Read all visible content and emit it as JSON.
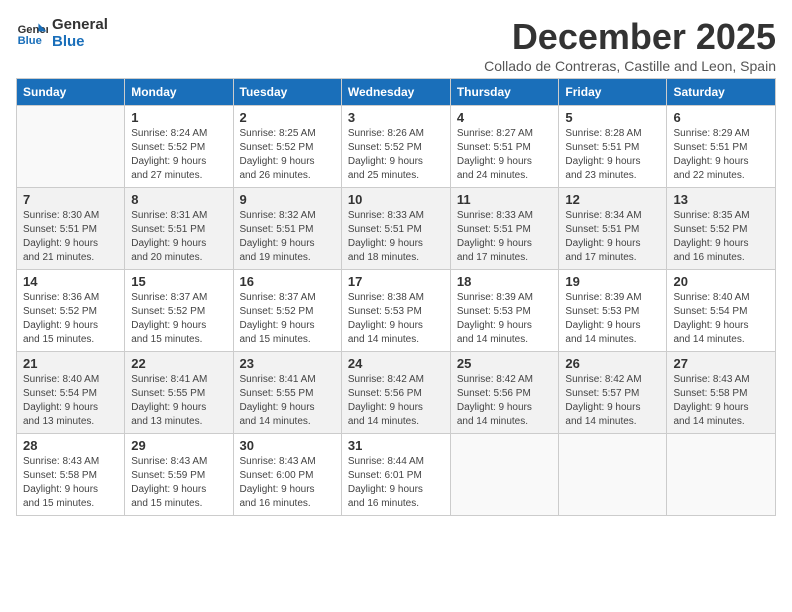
{
  "logo": {
    "line1": "General",
    "line2": "Blue"
  },
  "title": "December 2025",
  "subtitle": "Collado de Contreras, Castille and Leon, Spain",
  "weekdays": [
    "Sunday",
    "Monday",
    "Tuesday",
    "Wednesday",
    "Thursday",
    "Friday",
    "Saturday"
  ],
  "weeks": [
    [
      {
        "day": "",
        "info": ""
      },
      {
        "day": "1",
        "info": "Sunrise: 8:24 AM\nSunset: 5:52 PM\nDaylight: 9 hours\nand 27 minutes."
      },
      {
        "day": "2",
        "info": "Sunrise: 8:25 AM\nSunset: 5:52 PM\nDaylight: 9 hours\nand 26 minutes."
      },
      {
        "day": "3",
        "info": "Sunrise: 8:26 AM\nSunset: 5:52 PM\nDaylight: 9 hours\nand 25 minutes."
      },
      {
        "day": "4",
        "info": "Sunrise: 8:27 AM\nSunset: 5:51 PM\nDaylight: 9 hours\nand 24 minutes."
      },
      {
        "day": "5",
        "info": "Sunrise: 8:28 AM\nSunset: 5:51 PM\nDaylight: 9 hours\nand 23 minutes."
      },
      {
        "day": "6",
        "info": "Sunrise: 8:29 AM\nSunset: 5:51 PM\nDaylight: 9 hours\nand 22 minutes."
      }
    ],
    [
      {
        "day": "7",
        "info": "Sunrise: 8:30 AM\nSunset: 5:51 PM\nDaylight: 9 hours\nand 21 minutes."
      },
      {
        "day": "8",
        "info": "Sunrise: 8:31 AM\nSunset: 5:51 PM\nDaylight: 9 hours\nand 20 minutes."
      },
      {
        "day": "9",
        "info": "Sunrise: 8:32 AM\nSunset: 5:51 PM\nDaylight: 9 hours\nand 19 minutes."
      },
      {
        "day": "10",
        "info": "Sunrise: 8:33 AM\nSunset: 5:51 PM\nDaylight: 9 hours\nand 18 minutes."
      },
      {
        "day": "11",
        "info": "Sunrise: 8:33 AM\nSunset: 5:51 PM\nDaylight: 9 hours\nand 17 minutes."
      },
      {
        "day": "12",
        "info": "Sunrise: 8:34 AM\nSunset: 5:51 PM\nDaylight: 9 hours\nand 17 minutes."
      },
      {
        "day": "13",
        "info": "Sunrise: 8:35 AM\nSunset: 5:52 PM\nDaylight: 9 hours\nand 16 minutes."
      }
    ],
    [
      {
        "day": "14",
        "info": "Sunrise: 8:36 AM\nSunset: 5:52 PM\nDaylight: 9 hours\nand 15 minutes."
      },
      {
        "day": "15",
        "info": "Sunrise: 8:37 AM\nSunset: 5:52 PM\nDaylight: 9 hours\nand 15 minutes."
      },
      {
        "day": "16",
        "info": "Sunrise: 8:37 AM\nSunset: 5:52 PM\nDaylight: 9 hours\nand 15 minutes."
      },
      {
        "day": "17",
        "info": "Sunrise: 8:38 AM\nSunset: 5:53 PM\nDaylight: 9 hours\nand 14 minutes."
      },
      {
        "day": "18",
        "info": "Sunrise: 8:39 AM\nSunset: 5:53 PM\nDaylight: 9 hours\nand 14 minutes."
      },
      {
        "day": "19",
        "info": "Sunrise: 8:39 AM\nSunset: 5:53 PM\nDaylight: 9 hours\nand 14 minutes."
      },
      {
        "day": "20",
        "info": "Sunrise: 8:40 AM\nSunset: 5:54 PM\nDaylight: 9 hours\nand 14 minutes."
      }
    ],
    [
      {
        "day": "21",
        "info": "Sunrise: 8:40 AM\nSunset: 5:54 PM\nDaylight: 9 hours\nand 13 minutes."
      },
      {
        "day": "22",
        "info": "Sunrise: 8:41 AM\nSunset: 5:55 PM\nDaylight: 9 hours\nand 13 minutes."
      },
      {
        "day": "23",
        "info": "Sunrise: 8:41 AM\nSunset: 5:55 PM\nDaylight: 9 hours\nand 14 minutes."
      },
      {
        "day": "24",
        "info": "Sunrise: 8:42 AM\nSunset: 5:56 PM\nDaylight: 9 hours\nand 14 minutes."
      },
      {
        "day": "25",
        "info": "Sunrise: 8:42 AM\nSunset: 5:56 PM\nDaylight: 9 hours\nand 14 minutes."
      },
      {
        "day": "26",
        "info": "Sunrise: 8:42 AM\nSunset: 5:57 PM\nDaylight: 9 hours\nand 14 minutes."
      },
      {
        "day": "27",
        "info": "Sunrise: 8:43 AM\nSunset: 5:58 PM\nDaylight: 9 hours\nand 14 minutes."
      }
    ],
    [
      {
        "day": "28",
        "info": "Sunrise: 8:43 AM\nSunset: 5:58 PM\nDaylight: 9 hours\nand 15 minutes."
      },
      {
        "day": "29",
        "info": "Sunrise: 8:43 AM\nSunset: 5:59 PM\nDaylight: 9 hours\nand 15 minutes."
      },
      {
        "day": "30",
        "info": "Sunrise: 8:43 AM\nSunset: 6:00 PM\nDaylight: 9 hours\nand 16 minutes."
      },
      {
        "day": "31",
        "info": "Sunrise: 8:44 AM\nSunset: 6:01 PM\nDaylight: 9 hours\nand 16 minutes."
      },
      {
        "day": "",
        "info": ""
      },
      {
        "day": "",
        "info": ""
      },
      {
        "day": "",
        "info": ""
      }
    ]
  ]
}
